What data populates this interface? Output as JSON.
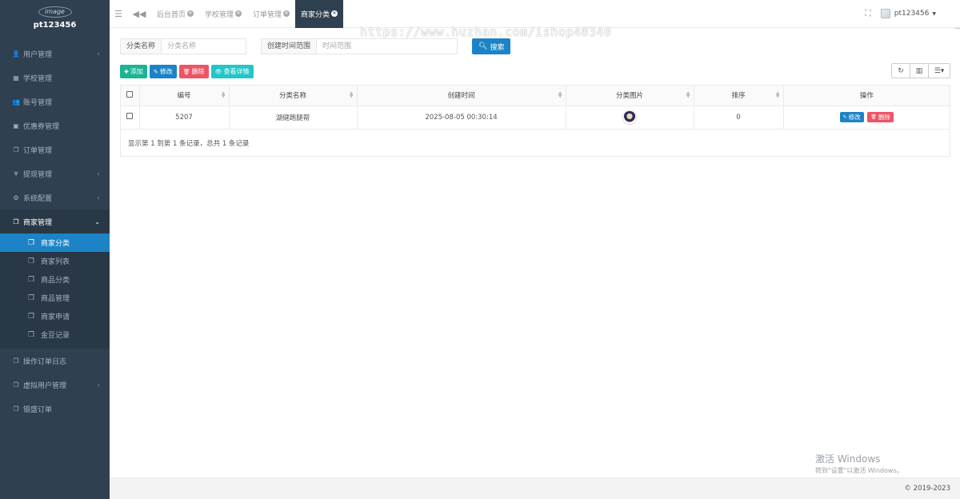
{
  "brand": {
    "logo_text": "image",
    "username": "pt123456"
  },
  "sidebar": {
    "items": [
      {
        "icon": "user-icon",
        "glyph": "👤",
        "label": "用户管理",
        "arrow": "‹"
      },
      {
        "icon": "school-icon",
        "glyph": "▦",
        "label": "学校管理",
        "arrow": ""
      },
      {
        "icon": "users-icon",
        "glyph": "👥",
        "label": "账号管理",
        "arrow": ""
      },
      {
        "icon": "coupon-icon",
        "glyph": "▣",
        "label": "优惠券管理",
        "arrow": ""
      },
      {
        "icon": "order-icon",
        "glyph": "❐",
        "label": "订单管理",
        "arrow": ""
      },
      {
        "icon": "yen-icon",
        "glyph": "¥",
        "label": "提现管理",
        "arrow": "‹"
      },
      {
        "icon": "gear-icon",
        "glyph": "⚙",
        "label": "系统配置",
        "arrow": "‹"
      },
      {
        "icon": "merchant-icon",
        "glyph": "❐",
        "label": "商家管理",
        "arrow": "⌄"
      }
    ],
    "submenu": [
      {
        "label": "商家分类",
        "active": true
      },
      {
        "label": "商家列表"
      },
      {
        "label": "商品分类"
      },
      {
        "label": "商品管理"
      },
      {
        "label": "商家申请"
      },
      {
        "label": "金豆记录"
      }
    ],
    "items_after": [
      {
        "icon": "log-icon",
        "glyph": "❐",
        "label": "操作订单日志",
        "arrow": ""
      },
      {
        "icon": "virtual-user-icon",
        "glyph": "❐",
        "label": "虚拟用户管理",
        "arrow": "‹"
      },
      {
        "icon": "bank-order-icon",
        "glyph": "❐",
        "label": "银盛订单",
        "arrow": ""
      }
    ]
  },
  "topbar": {
    "tabs": [
      {
        "label": "后台首页",
        "active": false
      },
      {
        "label": "学校管理",
        "active": false
      },
      {
        "label": "订单管理",
        "active": false
      },
      {
        "label": "商家分类",
        "active": true
      }
    ],
    "username": "pt123456"
  },
  "watermark": "https://www.huzhan.com/ishop40340",
  "search": {
    "name_label": "分类名称",
    "name_placeholder": "分类名称",
    "time_label": "创建时间范围",
    "time_placeholder": "时间范围",
    "search_label": "搜索"
  },
  "toolbar": {
    "add": "添加",
    "edit": "修改",
    "delete": "删除",
    "view": "查看详情"
  },
  "table": {
    "headers": [
      "编号",
      "分类名称",
      "创建时间",
      "分类图片",
      "排序",
      "操作"
    ],
    "rows": [
      {
        "id": "5207",
        "name": "湖健跑腿帮",
        "created": "2025-08-05 00:30:14",
        "sort": "0",
        "edit": "修改",
        "delete": "删除"
      }
    ],
    "pager": "显示第 1 到第 1 条记录，总共 1 条记录"
  },
  "footer": {
    "copyright": "© 2019-2023"
  },
  "activate": {
    "title": "激活 Windows",
    "hint": "转到\"设置\"以激活 Windows。"
  },
  "colors": {
    "sidebar": "#2f4050",
    "primary": "#1c84c6",
    "success": "#1ab394",
    "danger": "#ed5565",
    "info": "#23c6c8"
  }
}
